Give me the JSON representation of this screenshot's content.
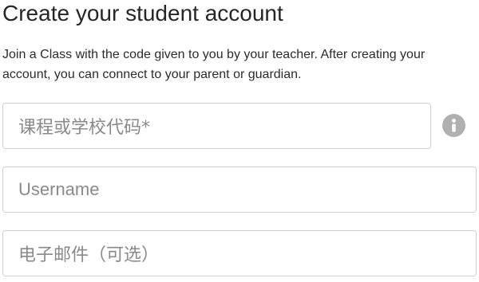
{
  "header": {
    "title": "Create your student account",
    "intro": "Join a Class with the code given to you by your teacher. After creating your account, you can connect to your parent or guardian."
  },
  "form": {
    "class_code": {
      "placeholder": "课程或学校代码*",
      "value": "",
      "info_icon": "info-icon"
    },
    "username": {
      "placeholder": "Username",
      "value": ""
    },
    "email": {
      "placeholder": "电子邮件（可选）",
      "value": ""
    }
  },
  "colors": {
    "title_text": "#262626",
    "body_text": "#2b2b2b",
    "placeholder_text": "#8a8a8a",
    "field_border": "#d0d0d0",
    "info_icon_bg": "#b0b0b0"
  }
}
